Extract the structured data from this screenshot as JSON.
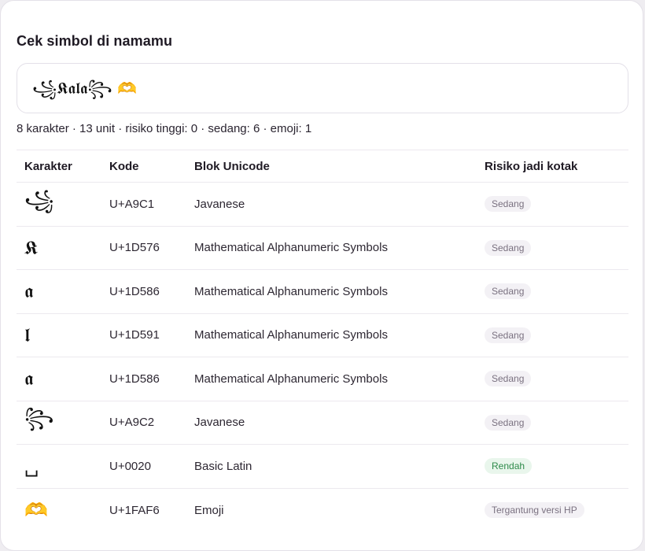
{
  "title": "Cek simbol di namamu",
  "input": {
    "value": "꧁𝕶𝖆𝖑𝖆꧂ 🫶"
  },
  "summary": "8 karakter · 13 unit · risiko tinggi: 0 · sedang: 6 · emoji: 1",
  "table": {
    "headers": [
      "Karakter",
      "Kode",
      "Blok Unicode",
      "Risiko jadi kotak"
    ],
    "rows": [
      {
        "char": "꧁",
        "code": "U+A9C1",
        "block": "Javanese",
        "risk": "Sedang"
      },
      {
        "char": "𝕶",
        "code": "U+1D576",
        "block": "Mathematical Alphanumeric Symbols",
        "risk": "Sedang"
      },
      {
        "char": "𝖆",
        "code": "U+1D586",
        "block": "Mathematical Alphanumeric Symbols",
        "risk": "Sedang"
      },
      {
        "char": "𝖑",
        "code": "U+1D591",
        "block": "Mathematical Alphanumeric Symbols",
        "risk": "Sedang"
      },
      {
        "char": "𝖆",
        "code": "U+1D586",
        "block": "Mathematical Alphanumeric Symbols",
        "risk": "Sedang"
      },
      {
        "char": "꧂",
        "code": "U+A9C2",
        "block": "Javanese",
        "risk": "Sedang"
      },
      {
        "char": "␣",
        "code": "U+0020",
        "block": "Basic Latin",
        "risk": "Rendah"
      },
      {
        "char": "🫶",
        "code": "U+1FAF6",
        "block": "Emoji",
        "risk": "Tergantung versi HP"
      }
    ]
  },
  "colors": {
    "badge_sedang_bg": "#f3f1f5",
    "badge_rendah_bg": "#e9f6ec",
    "badge_rendah_text": "#2e8a4a"
  }
}
